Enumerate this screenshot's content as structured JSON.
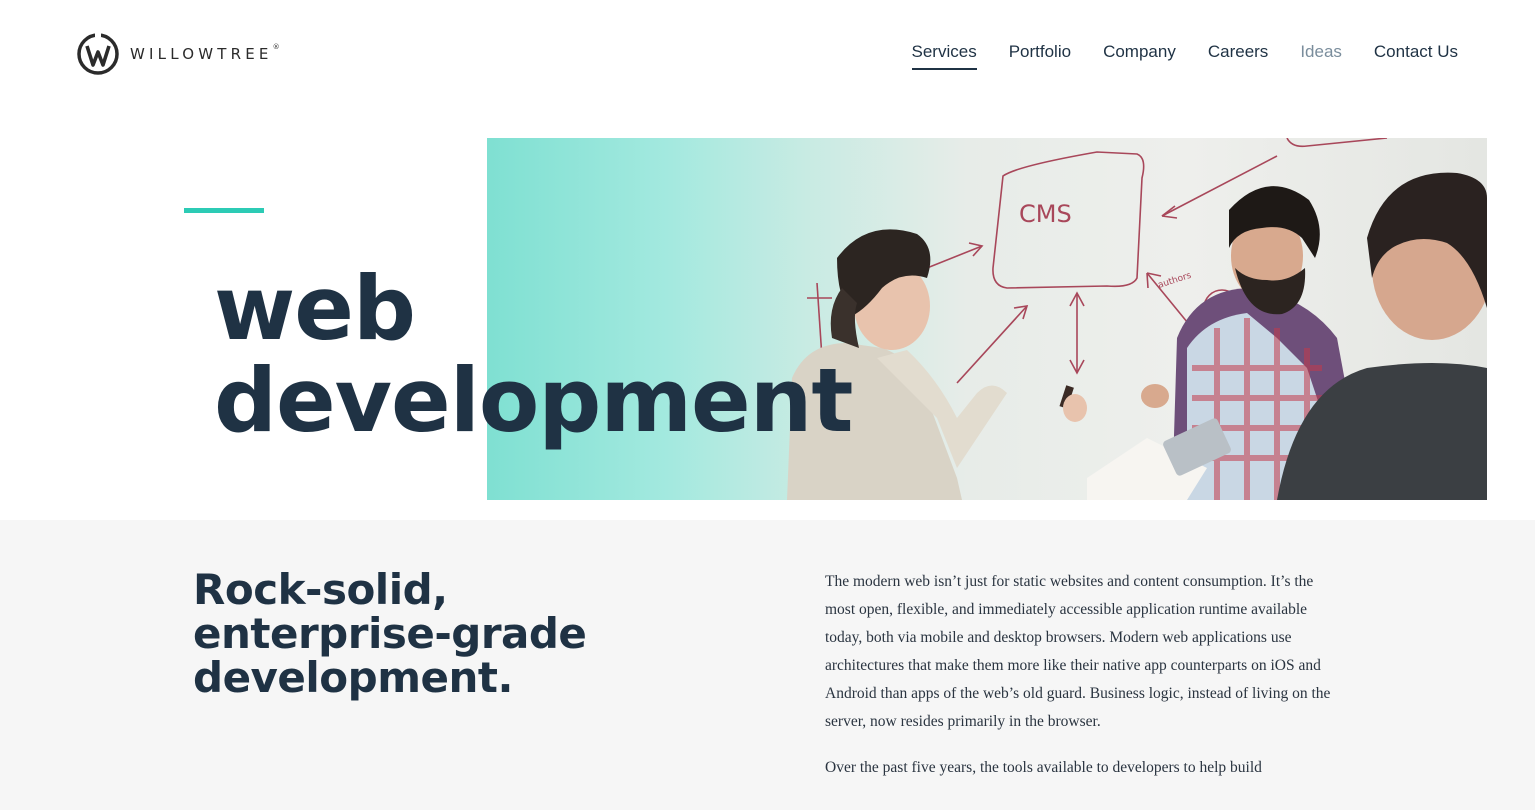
{
  "brand": {
    "name": "WILLOWTREE",
    "mark": "®"
  },
  "nav": {
    "items": [
      {
        "label": "Services",
        "state": "active"
      },
      {
        "label": "Portfolio",
        "state": "normal"
      },
      {
        "label": "Company",
        "state": "normal"
      },
      {
        "label": "Careers",
        "state": "normal"
      },
      {
        "label": "Ideas",
        "state": "muted"
      },
      {
        "label": "Contact Us",
        "state": "normal"
      }
    ]
  },
  "hero": {
    "title_line1": "web",
    "title_line2": "development",
    "whiteboard": {
      "cms": "CMS",
      "authors": "authors"
    },
    "accent_color": "#2ccbb5"
  },
  "content": {
    "heading": "Rock-solid, enterprise-grade development.",
    "paragraphs": [
      "The modern web isn’t just for static websites and content consumption. It’s the most open, flexible, and immediately accessible application runtime available today, both via mobile and desktop browsers. Modern web applications use architectures that make them more like their native app counterparts on iOS and Android than apps of the web’s old guard. Business logic, instead of living on the server, now resides primarily in the browser.",
      "Over the past five years, the tools available to developers to help build"
    ]
  },
  "colors": {
    "navy": "#1f3244",
    "muted_nav": "#7a8d9c",
    "content_bg": "#f6f6f6"
  }
}
